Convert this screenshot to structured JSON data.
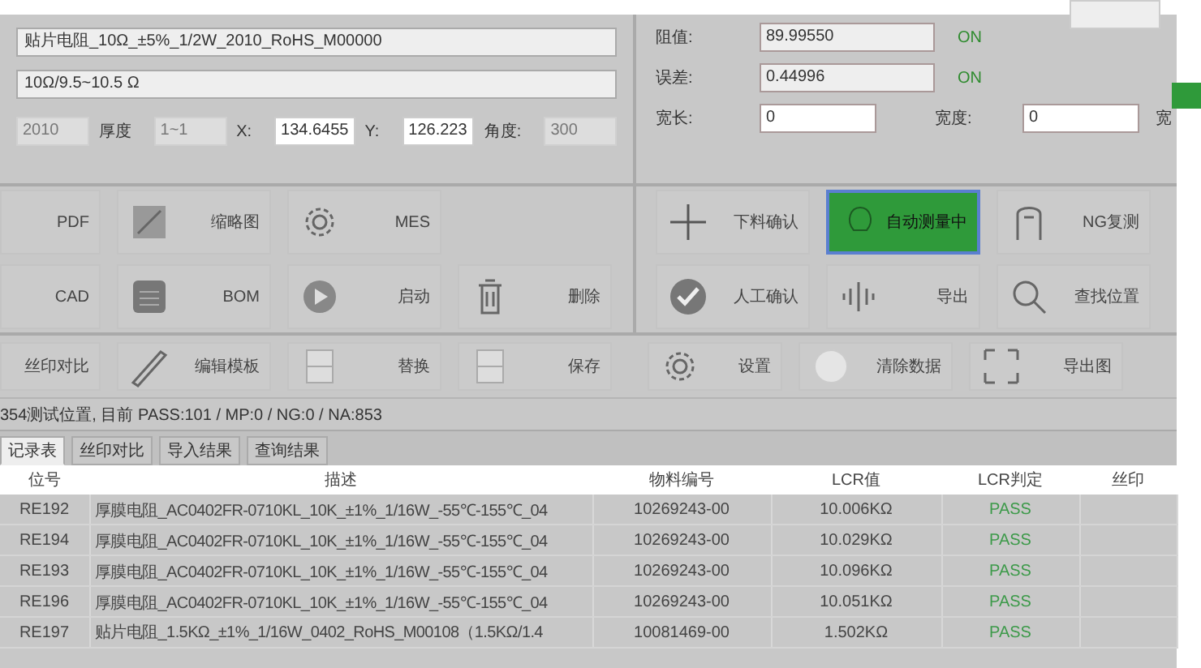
{
  "part": {
    "name": "贴片电阻_10Ω_±5%_1/2W_2010_RoHS_M00000",
    "spec": "10Ω/9.5~10.5 Ω",
    "params": [
      {
        "kind": "field",
        "value": "2010",
        "disabled": true
      },
      {
        "kind": "label",
        "text": "厚度"
      },
      {
        "kind": "field",
        "value": "1~1",
        "disabled": true
      },
      {
        "kind": "label",
        "text": "X:"
      },
      {
        "kind": "field",
        "value": "134.6455",
        "disabled": false
      },
      {
        "kind": "label",
        "text": "Y:"
      },
      {
        "kind": "field",
        "value": "126.223",
        "disabled": false
      },
      {
        "kind": "label",
        "text": "角度:"
      },
      {
        "kind": "field",
        "value": "300",
        "disabled": true
      }
    ]
  },
  "measure": {
    "rows": [
      {
        "label": "阻值:",
        "value": "89.99550",
        "flag": "ON"
      },
      {
        "label": "误差:",
        "value": "0.44996",
        "flag": "ON"
      }
    ],
    "limits": [
      {
        "label": "宽长:",
        "value": "0"
      },
      {
        "label": "宽度:",
        "value": "0"
      }
    ],
    "cut_label": "宽"
  },
  "left_buttons": [
    [
      {
        "label": "PDF",
        "active": false
      },
      {
        "label": "缩略图",
        "active": false
      },
      {
        "label": "MES",
        "active": false
      }
    ],
    [
      {
        "label": "CAD",
        "active": false
      },
      {
        "label": "BOM",
        "active": false
      },
      {
        "label": "启动",
        "active": false
      },
      {
        "label": "删除",
        "active": false
      }
    ]
  ],
  "right_buttons": [
    [
      {
        "label": "下料确认",
        "active": false
      },
      {
        "label": "自动测量中",
        "active": true
      },
      {
        "label": "NG复测",
        "active": false
      }
    ],
    [
      {
        "label": "人工确认",
        "active": false
      },
      {
        "label": "导出",
        "active": false
      },
      {
        "label": "查找位置",
        "active": false
      }
    ]
  ],
  "toolbar": [
    {
      "label": "丝印对比",
      "active": false
    },
    {
      "label": "编辑模板",
      "active": false
    },
    {
      "label": "替换",
      "active": false
    },
    {
      "label": "保存",
      "active": false
    },
    {
      "label": "设置",
      "active": false
    },
    {
      "label": "清除数据",
      "active": false
    },
    {
      "label": "导出图",
      "active": false
    }
  ],
  "status_line": "354测试位置, 目前 PASS:101 / MP:0 / NG:0 / NA:853",
  "tabs": [
    {
      "label": "记录表",
      "selected": true
    },
    {
      "label": "丝印对比",
      "selected": false
    },
    {
      "label": "导入结果",
      "selected": false
    },
    {
      "label": "查询结果",
      "selected": false
    }
  ],
  "table": {
    "columns": [
      "位号",
      "描述",
      "物料编号",
      "LCR值",
      "LCR判定",
      "丝印"
    ],
    "rows": [
      [
        "RE192",
        "厚膜电阻_AC0402FR-0710KL_10K_±1%_1/16W_-55℃-155℃_04",
        "10269243-00",
        "10.006KΩ",
        "PASS",
        ""
      ],
      [
        "RE194",
        "厚膜电阻_AC0402FR-0710KL_10K_±1%_1/16W_-55℃-155℃_04",
        "10269243-00",
        "10.029KΩ",
        "PASS",
        ""
      ],
      [
        "RE193",
        "厚膜电阻_AC0402FR-0710KL_10K_±1%_1/16W_-55℃-155℃_04",
        "10269243-00",
        "10.096KΩ",
        "PASS",
        ""
      ],
      [
        "RE196",
        "厚膜电阻_AC0402FR-0710KL_10K_±1%_1/16W_-55℃-155℃_04",
        "10269243-00",
        "10.051KΩ",
        "PASS",
        ""
      ],
      [
        "RE197",
        "贴片电阻_1.5KΩ_±1%_1/16W_0402_RoHS_M00108（1.5KΩ/1.4",
        "10081469-00",
        "1.502KΩ",
        "PASS",
        ""
      ]
    ]
  }
}
